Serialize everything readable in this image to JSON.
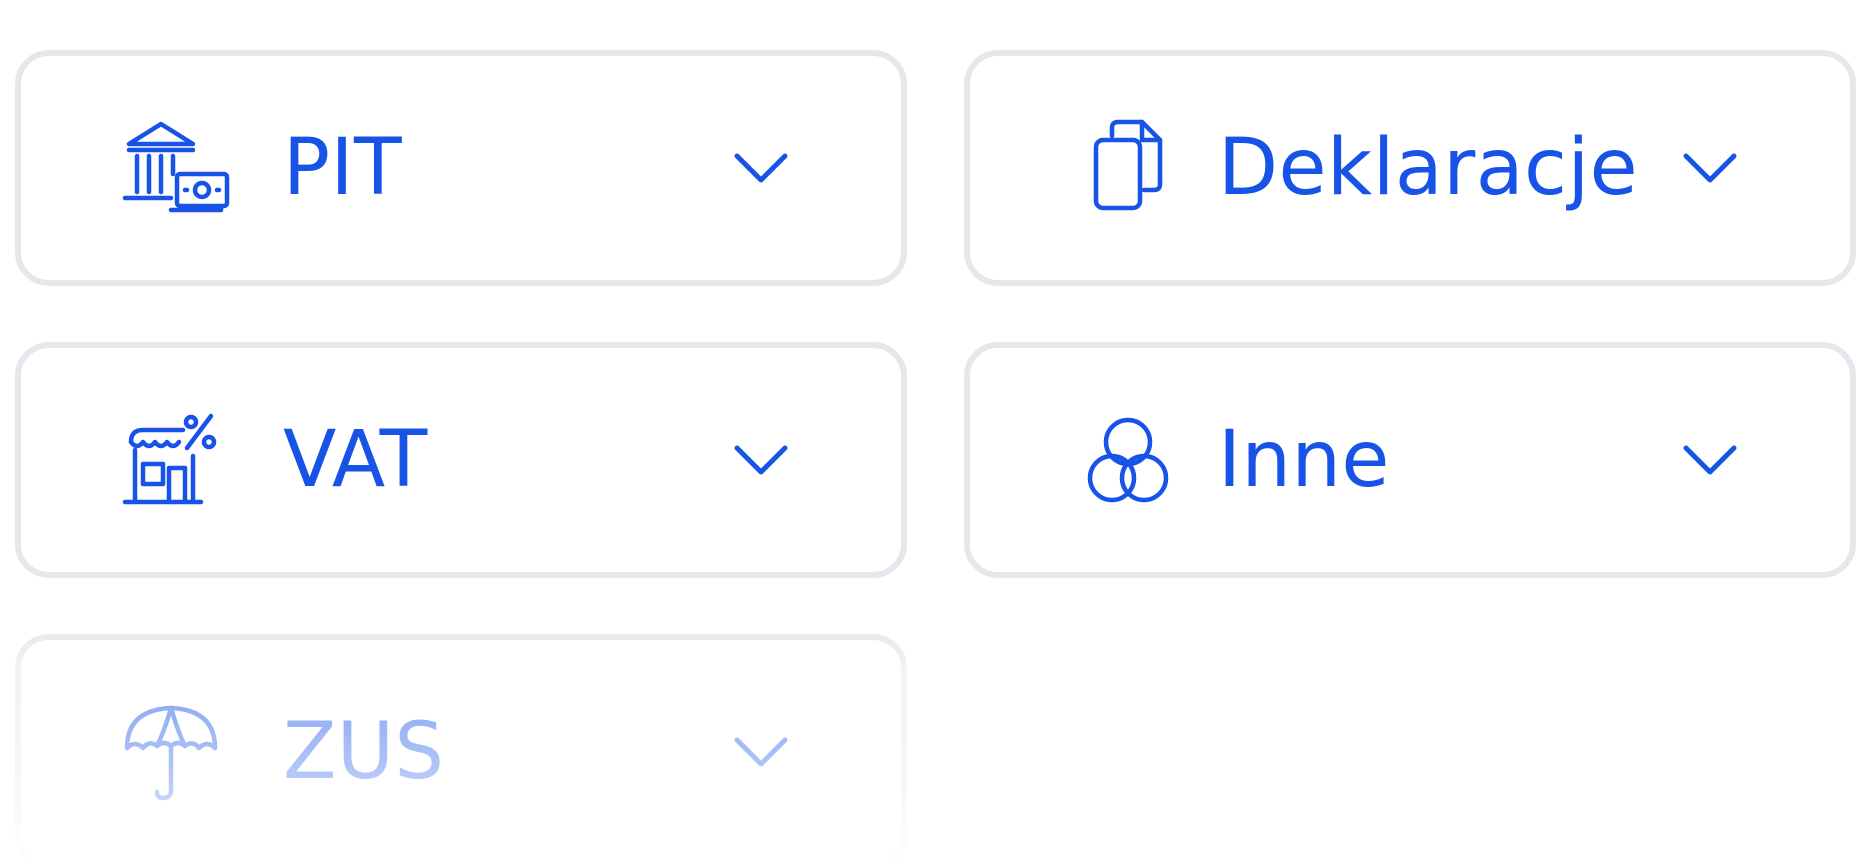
{
  "accent_color": "#1753e6",
  "border_color": "#e6e7ec",
  "cards": [
    {
      "label": "PIT",
      "icon": "bank-money-icon",
      "chevron": "chevron-down-icon"
    },
    {
      "label": "Deklaracje",
      "icon": "documents-copy-icon",
      "chevron": "chevron-down-icon"
    },
    {
      "label": "VAT",
      "icon": "shop-percent-icon",
      "chevron": "chevron-down-icon"
    },
    {
      "label": "Inne",
      "icon": "three-circles-icon",
      "chevron": "chevron-down-icon"
    },
    {
      "label": "ZUS",
      "icon": "umbrella-icon",
      "chevron": "chevron-down-icon"
    }
  ]
}
